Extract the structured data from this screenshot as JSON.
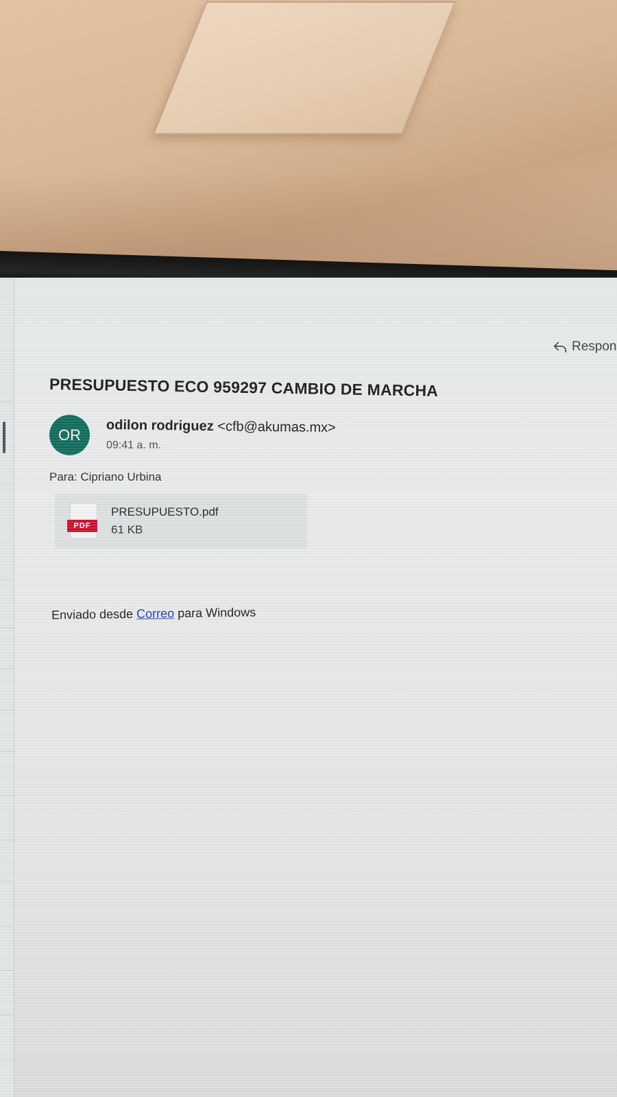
{
  "toolbar": {
    "reply_label": "Respond"
  },
  "message": {
    "subject": "PRESUPUESTO ECO 959297 CAMBIO DE MARCHA",
    "sender": {
      "initials": "OR",
      "name": "odilon rodriguez",
      "email": "<cfb@akumas.mx>",
      "avatar_color": "#0f6b5a"
    },
    "time": "09:41 a. m.",
    "to_label": "Para:",
    "to_value": "Cipriano Urbina",
    "attachment": {
      "badge": "PDF",
      "file_name": "PRESUPUESTO.pdf",
      "file_size": "61 KB",
      "badge_color": "#c8102e"
    },
    "body": {
      "prefix": "Enviado desde",
      "link": "Correo",
      "suffix": "para Windows"
    }
  },
  "icons": [
    "reply-icon",
    "pdf-file-icon"
  ]
}
